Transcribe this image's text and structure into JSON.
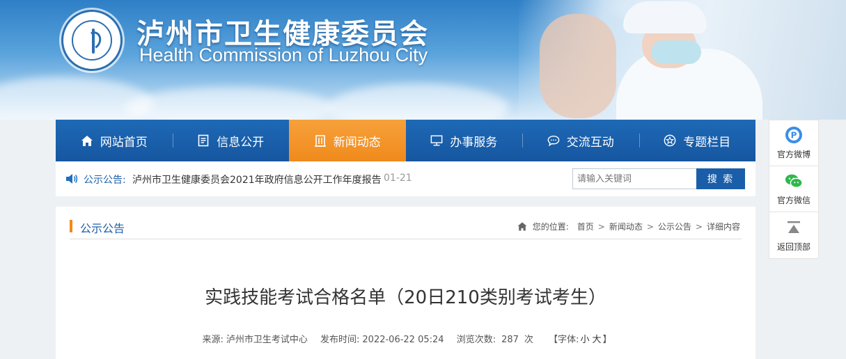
{
  "header": {
    "title_cn": "泸州市卫生健康委员会",
    "title_en": "Health Commission of Luzhou City",
    "logo_icon": "emblem-logo-icon"
  },
  "nav": {
    "items": [
      {
        "label": "网站首页",
        "icon": "home-icon",
        "active": false
      },
      {
        "label": "信息公开",
        "icon": "document-icon",
        "active": false
      },
      {
        "label": "新闻动态",
        "icon": "building-icon",
        "active": true
      },
      {
        "label": "办事服务",
        "icon": "monitor-icon",
        "active": false
      },
      {
        "label": "交流互动",
        "icon": "chat-icon",
        "active": false
      },
      {
        "label": "专题栏目",
        "icon": "star-icon",
        "active": false
      }
    ],
    "accent_color": "#1a5ea9",
    "active_color": "#f08a1c"
  },
  "notice": {
    "label": "公示公告:",
    "text": "泸州市卫生健康委员会2021年政府信息公开工作年度报告",
    "date": "01-21"
  },
  "search": {
    "placeholder": "请输入关键词",
    "value": "",
    "button_label": "搜 索"
  },
  "section": {
    "title": "公示公告"
  },
  "breadcrumb": {
    "prefix": "您的位置:",
    "items": [
      "首页",
      "新闻动态",
      "公示公告",
      "详细内容"
    ],
    "separator": ">"
  },
  "article": {
    "title": "实践技能考试合格名单（20日210类别考试考生）",
    "source_label": "来源:",
    "source": "泸州市卫生考试中心",
    "publish_label": "发布时间:",
    "publish_time": "2022-06-22 05:24",
    "views_label": "浏览次数:",
    "views": "287",
    "views_unit": "次",
    "font_label": "【字体:",
    "font_small": "小",
    "font_large": "大",
    "font_close": "】"
  },
  "side": {
    "items": [
      {
        "label": "官方微博",
        "icon": "weibo-icon"
      },
      {
        "label": "官方微信",
        "icon": "wechat-icon"
      },
      {
        "label": "返回顶部",
        "icon": "back-to-top-icon"
      }
    ]
  }
}
